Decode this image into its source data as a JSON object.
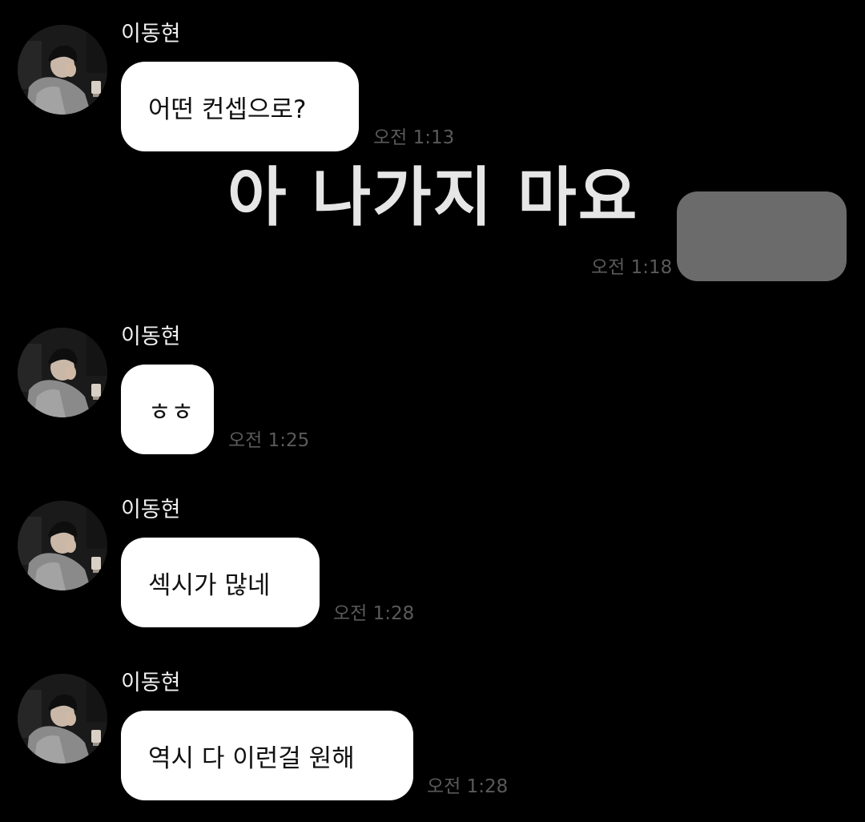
{
  "sender_name": "이동현",
  "messages": [
    {
      "sender": "이동현",
      "text": "어떤 컨셉으로?",
      "time": "오전 1:13"
    },
    {
      "sender": "me",
      "text": "",
      "time": "오전 1:18"
    },
    {
      "sender": "이동현",
      "text": "ㅎㅎ",
      "time": "오전 1:25"
    },
    {
      "sender": "이동현",
      "text": "섹시가 많네",
      "time": "오전 1:28"
    },
    {
      "sender": "이동현",
      "text": "역시 다 이런걸 원해",
      "time": "오전 1:28"
    }
  ],
  "overlay_caption": "아 나가지 마요",
  "colors": {
    "background": "#000000",
    "incoming_bubble": "#ffffff",
    "outgoing_bubble_redacted": "#6b6b6b",
    "timestamp": "#5a5a5a"
  },
  "icons": [
    "avatar-photo"
  ]
}
